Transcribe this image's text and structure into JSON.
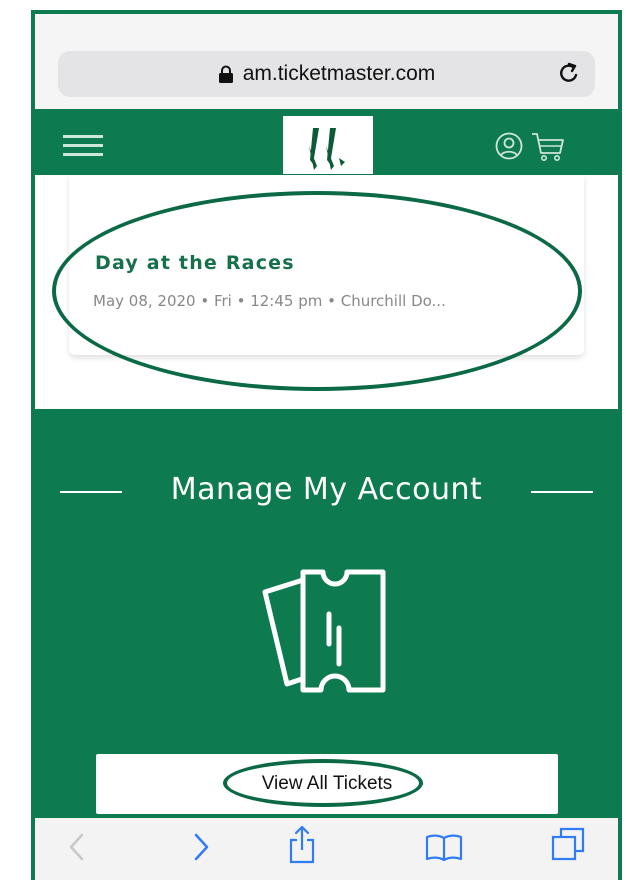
{
  "browser": {
    "url": "am.ticketmaster.com",
    "icons": {
      "lock": "lock-icon",
      "reload": "reload-icon"
    }
  },
  "header": {
    "icons": {
      "menu": "menu-icon",
      "logo": "logo",
      "user": "user-icon",
      "cart": "cart-icon"
    }
  },
  "event": {
    "title": "Day at the Races",
    "meta": "May 08, 2020 • Fri • 12:45 pm • Churchill Do..."
  },
  "manage": {
    "heading": "Manage My Account",
    "icon": "ticket-icon",
    "button_label": "View All Tickets"
  },
  "toolbar": {
    "icons": [
      "back-icon",
      "forward-icon",
      "share-icon",
      "bookmarks-icon",
      "tabs-icon"
    ]
  },
  "colors": {
    "brand_green": "#0d7a4f",
    "title_green": "#16704a",
    "annotation": "#0b6a45"
  }
}
